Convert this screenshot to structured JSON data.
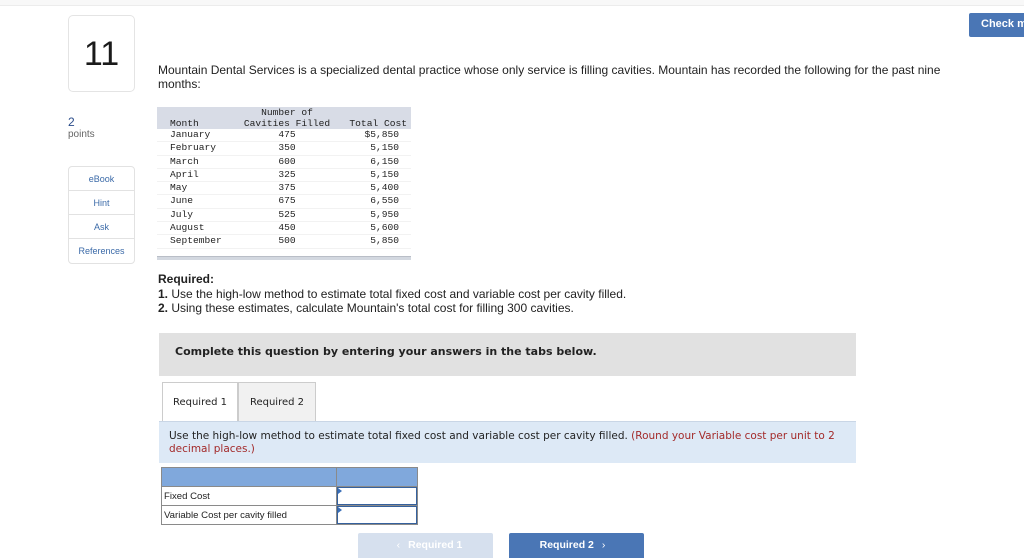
{
  "header": {
    "check_button_label": "Check my work"
  },
  "question": {
    "number": "11",
    "points_value": "2",
    "points_label": "points"
  },
  "side_menu": {
    "items": [
      {
        "label": "eBook"
      },
      {
        "label": "Hint"
      },
      {
        "label": "Ask"
      },
      {
        "label": "References"
      }
    ]
  },
  "intro_text": "Mountain Dental Services is a specialized dental practice whose only service is filling cavities. Mountain has recorded the following for the past nine months:",
  "data_table": {
    "headers": {
      "month": "Month",
      "cavities_line1": "Number of",
      "cavities_line2": "Cavities Filled",
      "cost": "Total Cost"
    },
    "rows": [
      {
        "month": "January",
        "cavities": "475",
        "cost": "$5,850"
      },
      {
        "month": "February",
        "cavities": "350",
        "cost": "5,150"
      },
      {
        "month": "March",
        "cavities": "600",
        "cost": "6,150"
      },
      {
        "month": "April",
        "cavities": "325",
        "cost": "5,150"
      },
      {
        "month": "May",
        "cavities": "375",
        "cost": "5,400"
      },
      {
        "month": "June",
        "cavities": "675",
        "cost": "6,550"
      },
      {
        "month": "July",
        "cavities": "525",
        "cost": "5,950"
      },
      {
        "month": "August",
        "cavities": "450",
        "cost": "5,600"
      },
      {
        "month": "September",
        "cavities": "500",
        "cost": "5,850"
      }
    ]
  },
  "required": {
    "heading": "Required:",
    "items": [
      {
        "num": "1.",
        "text": " Use the high-low method to estimate total fixed cost and variable cost per cavity filled."
      },
      {
        "num": "2.",
        "text": " Using these estimates, calculate Mountain's total cost for filling 300 cavities."
      }
    ]
  },
  "instruction_bar": "Complete this question by entering your answers in the tabs below.",
  "tabs": [
    {
      "label": "Required 1",
      "active": true
    },
    {
      "label": "Required 2",
      "active": false
    }
  ],
  "tab_panel": {
    "text": "Use the high-low method to estimate total fixed cost and variable cost per cavity filled. ",
    "hint": "(Round your Variable cost per unit to 2 decimal places.)"
  },
  "answer_table": {
    "rows": [
      {
        "label": "Fixed Cost",
        "value": ""
      },
      {
        "label": "Variable Cost per cavity filled",
        "value": ""
      }
    ]
  },
  "nav": {
    "prev_label": "Required 1",
    "prev_icon": "chevron-left-icon",
    "next_label": "Required 2",
    "next_icon": "chevron-right-icon"
  }
}
